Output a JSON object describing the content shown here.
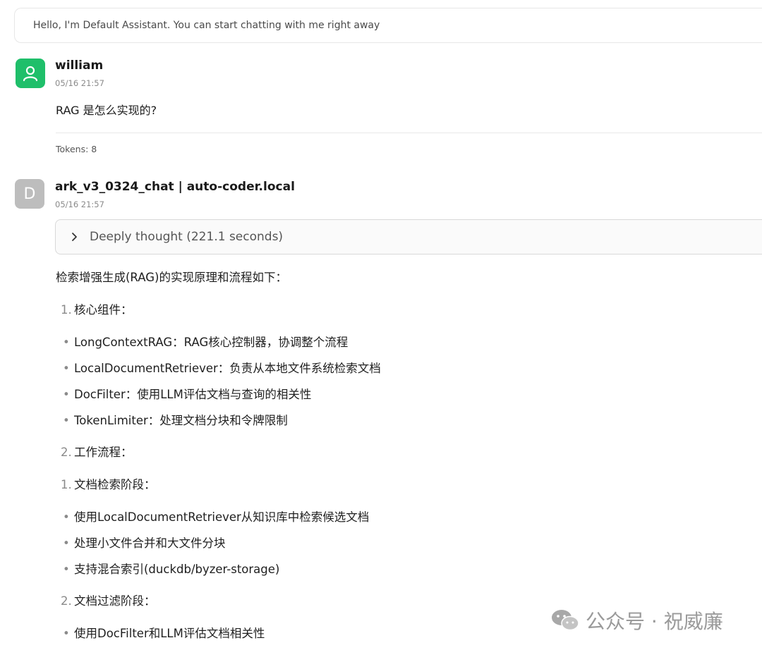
{
  "greeting": "Hello, I'm Default Assistant. You can start chatting with me right away",
  "user_message": {
    "sender": "william",
    "time": "05/16 21:57",
    "text": "RAG 是怎么实现的?",
    "tokens": "Tokens: 8"
  },
  "bot_message": {
    "avatar_letter": "D",
    "sender": "ark_v3_0324_chat | auto-coder.local",
    "time": "05/16 21:57",
    "thought_label": "Deeply thought (221.1 seconds)",
    "intro": "检索增强生成(RAG)的实现原理和流程如下：",
    "items": [
      {
        "kind": "num",
        "marker": "1.",
        "text": "核心组件："
      },
      {
        "kind": "bullet",
        "text": "LongContextRAG：RAG核心控制器，协调整个流程"
      },
      {
        "kind": "bullet",
        "text": "LocalDocumentRetriever：负责从本地文件系统检索文档"
      },
      {
        "kind": "bullet",
        "text": "DocFilter：使用LLM评估文档与查询的相关性"
      },
      {
        "kind": "bullet",
        "text": "TokenLimiter：处理文档分块和令牌限制"
      },
      {
        "kind": "num",
        "marker": "2.",
        "text": "工作流程："
      },
      {
        "kind": "num",
        "marker": "1.",
        "text": "文档检索阶段："
      },
      {
        "kind": "bullet",
        "text": "使用LocalDocumentRetriever从知识库中检索候选文档"
      },
      {
        "kind": "bullet",
        "text": "处理小文件合并和大文件分块"
      },
      {
        "kind": "bullet",
        "text": "支持混合索引(duckdb/byzer-storage)"
      },
      {
        "kind": "num",
        "marker": "2.",
        "text": "文档过滤阶段："
      },
      {
        "kind": "bullet",
        "text": "使用DocFilter和LLM评估文档相关性"
      }
    ]
  },
  "watermark": {
    "text": "公众号 · 祝威廉"
  },
  "icons": {
    "user_avatar": "person-icon",
    "thought_toggle": "chevron-right-icon",
    "watermark": "wechat-icon"
  },
  "colors": {
    "user_avatar": "#1fbf6a",
    "bot_avatar": "#bdbdbd"
  }
}
